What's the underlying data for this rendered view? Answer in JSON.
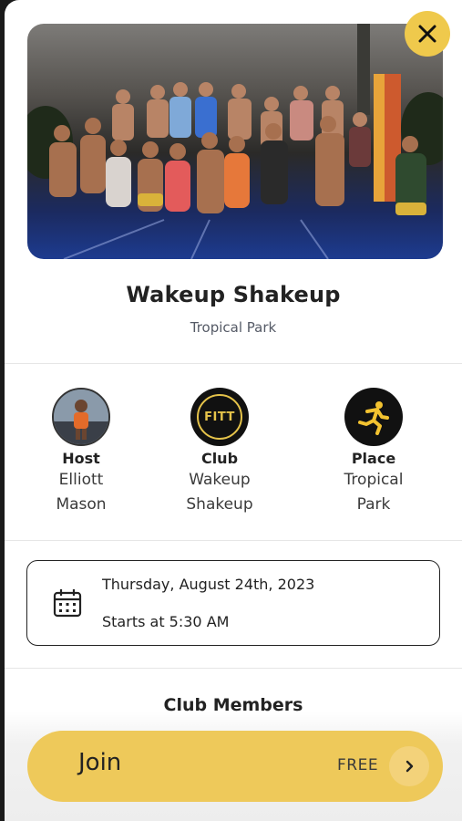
{
  "event": {
    "title": "Wakeup Shakeup",
    "location": "Tropical Park",
    "photo_icon": "group-photo"
  },
  "close": {
    "icon": "close-icon"
  },
  "meta": {
    "host": {
      "label": "Host",
      "value_line1": "Elliott",
      "value_line2": "Mason",
      "icon": "host-avatar"
    },
    "club": {
      "label": "Club",
      "value_line1": "Wakeup",
      "value_line2": "Shakeup",
      "logo_text": "FITT"
    },
    "place": {
      "label": "Place",
      "value_line1": "Tropical",
      "value_line2": "Park",
      "icon": "running-person-icon"
    }
  },
  "schedule": {
    "date": "Thursday, August 24th, 2023",
    "time": "Starts at 5:30 AM",
    "icon": "calendar-icon"
  },
  "members": {
    "title": "Club Members"
  },
  "join": {
    "label": "Join",
    "price": "FREE",
    "icon": "chevron-right-icon"
  },
  "colors": {
    "accent": "#eec95a",
    "close_bg": "#efc94c",
    "text": "#222222"
  }
}
